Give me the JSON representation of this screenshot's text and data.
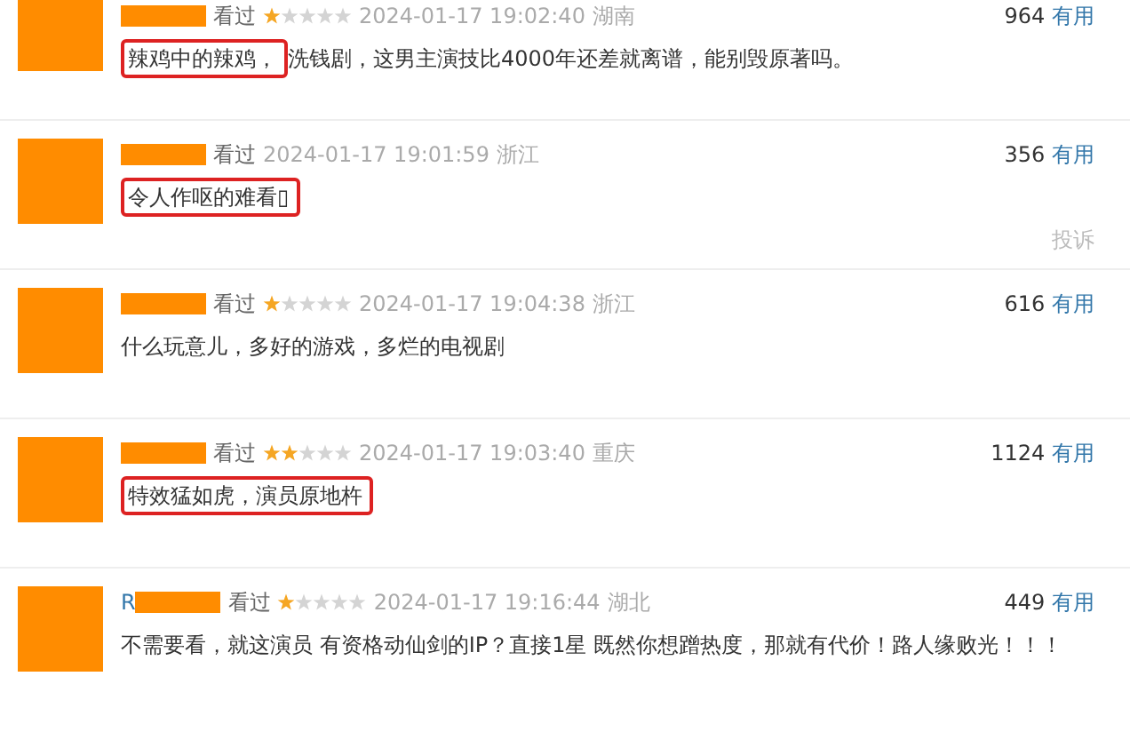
{
  "reviews": [
    {
      "status": "看过",
      "stars": 1,
      "date": "2024-01-17 19:02:40",
      "location": "湖南",
      "votes": "964",
      "useful": "有用",
      "text": [
        {
          "text": "辣鸡中的辣鸡，",
          "highlighted": true
        },
        {
          "text": "洗钱剧，这男主演技比4000年还差就离谱，能别毁原著吗。",
          "highlighted": false
        }
      ]
    },
    {
      "status": "看过",
      "date": "2024-01-17 19:01:59",
      "location": "浙江",
      "votes": "356",
      "useful": "有用",
      "report": "投诉",
      "text": [
        {
          "text": "令人作呕的难看▯",
          "highlighted": true
        }
      ]
    },
    {
      "status": "看过",
      "stars": 1,
      "date": "2024-01-17 19:04:38",
      "location": "浙江",
      "votes": "616",
      "useful": "有用",
      "text": [
        {
          "text": "什么玩意儿，多好的游戏，多烂的电视剧",
          "highlighted": false
        }
      ]
    },
    {
      "status": "看过",
      "stars": 2,
      "date": "2024-01-17 19:03:40",
      "location": "重庆",
      "votes": "1124",
      "useful": "有用",
      "text": [
        {
          "text": "特效猛如虎，演员原地杵",
          "highlighted": true
        }
      ]
    },
    {
      "user_prefix": "R",
      "status": "看过",
      "stars": 1,
      "date": "2024-01-17 19:16:44",
      "location": "湖北",
      "votes": "449",
      "useful": "有用",
      "text": [
        {
          "text": "不需要看，就这演员 有资格动仙剑的IP？直接1星 既然你想蹭热度，那就有代价！路人缘败光！！！",
          "highlighted": false
        }
      ]
    }
  ]
}
